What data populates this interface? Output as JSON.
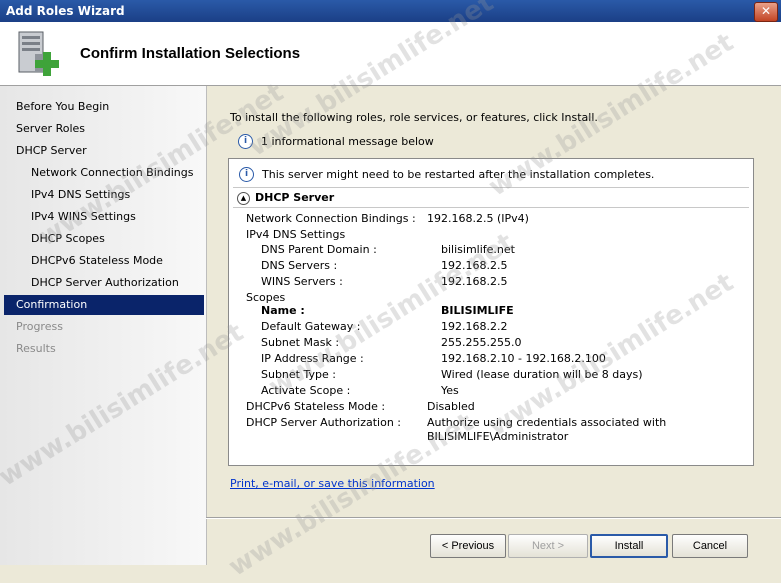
{
  "window": {
    "title": "Add Roles Wizard",
    "close_label": "✕"
  },
  "header": {
    "title": "Confirm Installation Selections"
  },
  "nav": {
    "items": [
      {
        "label": "Before You Begin"
      },
      {
        "label": "Server Roles"
      },
      {
        "label": "DHCP Server"
      },
      {
        "label": "Network Connection Bindings"
      },
      {
        "label": "IPv4 DNS Settings"
      },
      {
        "label": "IPv4 WINS Settings"
      },
      {
        "label": "DHCP Scopes"
      },
      {
        "label": "DHCPv6 Stateless Mode"
      },
      {
        "label": "DHCP Server Authorization"
      },
      {
        "label": "Confirmation"
      },
      {
        "label": "Progress"
      },
      {
        "label": "Results"
      }
    ],
    "selected": "Confirmation"
  },
  "main": {
    "intro": "To install the following roles, role services, or features, click Install.",
    "info_message": "1 informational message below",
    "restart_note": "This server might need to be restarted after the installation completes.",
    "section_title": "DHCP Server",
    "details": {
      "ncb_label": "Network Connection Bindings :",
      "ncb_value": "192.168.2.5 (IPv4)",
      "dns_settings_label": "IPv4 DNS Settings",
      "dns_parent_label": "DNS Parent Domain :",
      "dns_parent_value": "bilisimlife.net",
      "dns_servers_label": "DNS Servers :",
      "dns_servers_value": "192.168.2.5",
      "wins_label": "WINS Servers :",
      "wins_value": "192.168.2.5",
      "scopes_label": "Scopes",
      "name_label": "Name :",
      "name_value": "BILISIMLIFE",
      "gateway_label": "Default Gateway :",
      "gateway_value": "192.168.2.2",
      "mask_label": "Subnet Mask :",
      "mask_value": "255.255.255.0",
      "range_label": "IP Address Range :",
      "range_value": "192.168.2.10 - 192.168.2.100",
      "subnet_type_label": "Subnet Type :",
      "subnet_type_value": "Wired (lease duration will be 8 days)",
      "activate_label": "Activate Scope :",
      "activate_value": "Yes",
      "v6_label": "DHCPv6 Stateless Mode :",
      "v6_value": "Disabled",
      "auth_label": "DHCP Server Authorization :",
      "auth_value_line1": "Authorize using credentials associated with",
      "auth_value_line2": "BILISIMLIFE\\Administrator"
    },
    "print_link": "Print, e-mail, or save this information"
  },
  "buttons": {
    "previous": "< Previous",
    "next": "Next >",
    "install": "Install",
    "cancel": "Cancel"
  },
  "watermark": "www.bilisimlife.net"
}
